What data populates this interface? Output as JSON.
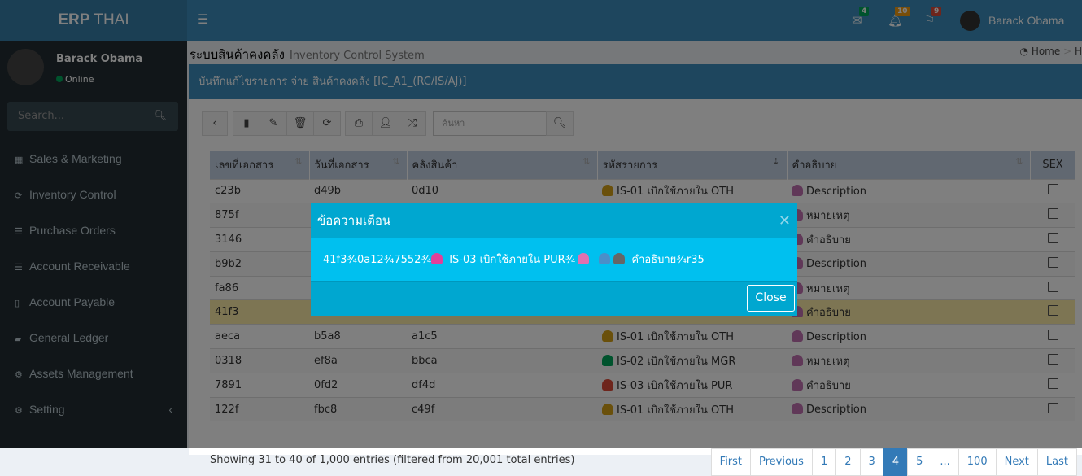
{
  "app": {
    "logo_bold": "ERP",
    "logo_rest": " THAI",
    "user": "Barack Obama"
  },
  "header": {
    "badges": {
      "mail": "4",
      "bell": "10",
      "flag": "9"
    },
    "colors": {
      "mail": "#00a65a",
      "bell": "#f39c12",
      "flag": "#dd4b39"
    }
  },
  "sidebar": {
    "user": "Barack Obama",
    "status": "Online",
    "search_placeholder": "Search...",
    "items": [
      {
        "label": "Sales & Marketing",
        "icon": "grid-icon"
      },
      {
        "label": "Inventory Control",
        "icon": "refresh-icon"
      },
      {
        "label": "Purchase Orders",
        "icon": "list-icon"
      },
      {
        "label": "Account Receivable",
        "icon": "list-icon"
      },
      {
        "label": "Account Payable",
        "icon": "file-icon"
      },
      {
        "label": "General Ledger",
        "icon": "book-icon"
      },
      {
        "label": "Assets Management",
        "icon": "gears-icon"
      },
      {
        "label": "Setting",
        "icon": "gears-icon"
      }
    ]
  },
  "page": {
    "title": "ระบบสินค้าคงคลัง",
    "subtitle": "Inventory Control System",
    "breadcrumb": [
      "Home",
      "H"
    ],
    "box_title": "บันทึกแก้ไขรายการ จ่าย สินค้าคงคลัง [IC_A1_(RC/IS/AJ)]",
    "search_placeholder": "ค้นหา"
  },
  "table": {
    "headers": [
      "เลขที่เอกสาร",
      "วันที่เอกสาร",
      "คลังสินค้า",
      "รหัสรายการ",
      "คำอธิบาย",
      "SEX"
    ],
    "rows": [
      [
        "c23b",
        "d49b",
        "0d10",
        "IS-01 เบิกใช้ภายใน OTH",
        "Description"
      ],
      [
        "875f",
        "",
        "",
        "",
        "หมายเหตุ"
      ],
      [
        "3146",
        "",
        "",
        "",
        "คำอธิบาย"
      ],
      [
        "b9b2",
        "",
        "",
        "",
        "Description"
      ],
      [
        "fa86",
        "",
        "",
        "",
        "หมายเหตุ"
      ],
      [
        "41f3",
        "",
        "",
        "",
        "คำอธิบาย"
      ],
      [
        "aeca",
        "b5a8",
        "a1c5",
        "IS-01 เบิกใช้ภายใน OTH",
        "Description"
      ],
      [
        "0318",
        "ef8a",
        "bbca",
        "IS-02 เบิกใช้ภายใน MGR",
        "หมายเหตุ"
      ],
      [
        "7891",
        "0fd2",
        "df4d",
        "IS-03 เบิกใช้ภายใน PUR",
        "คำอธิบาย"
      ],
      [
        "122f",
        "fbc8",
        "c49f",
        "IS-01 เบิกใช้ภายใน OTH",
        "Description"
      ]
    ]
  },
  "footer": {
    "info": "Showing 31 to 40 of 1,000 entries (filtered from 20,001 total entries)",
    "pages": [
      "First",
      "Previous",
      "1",
      "2",
      "3",
      "4",
      "5",
      "...",
      "100",
      "Next",
      "Last"
    ],
    "active_page": "4"
  },
  "modal": {
    "title": "ข้อความเตือน",
    "msg_a": "41f3¾0a12¾7552¾",
    "msg_b": " IS-03 เบิกใช้ภายใน PUR¾",
    "msg_c": " คำอธิบาย¾r35",
    "close": "Close"
  }
}
